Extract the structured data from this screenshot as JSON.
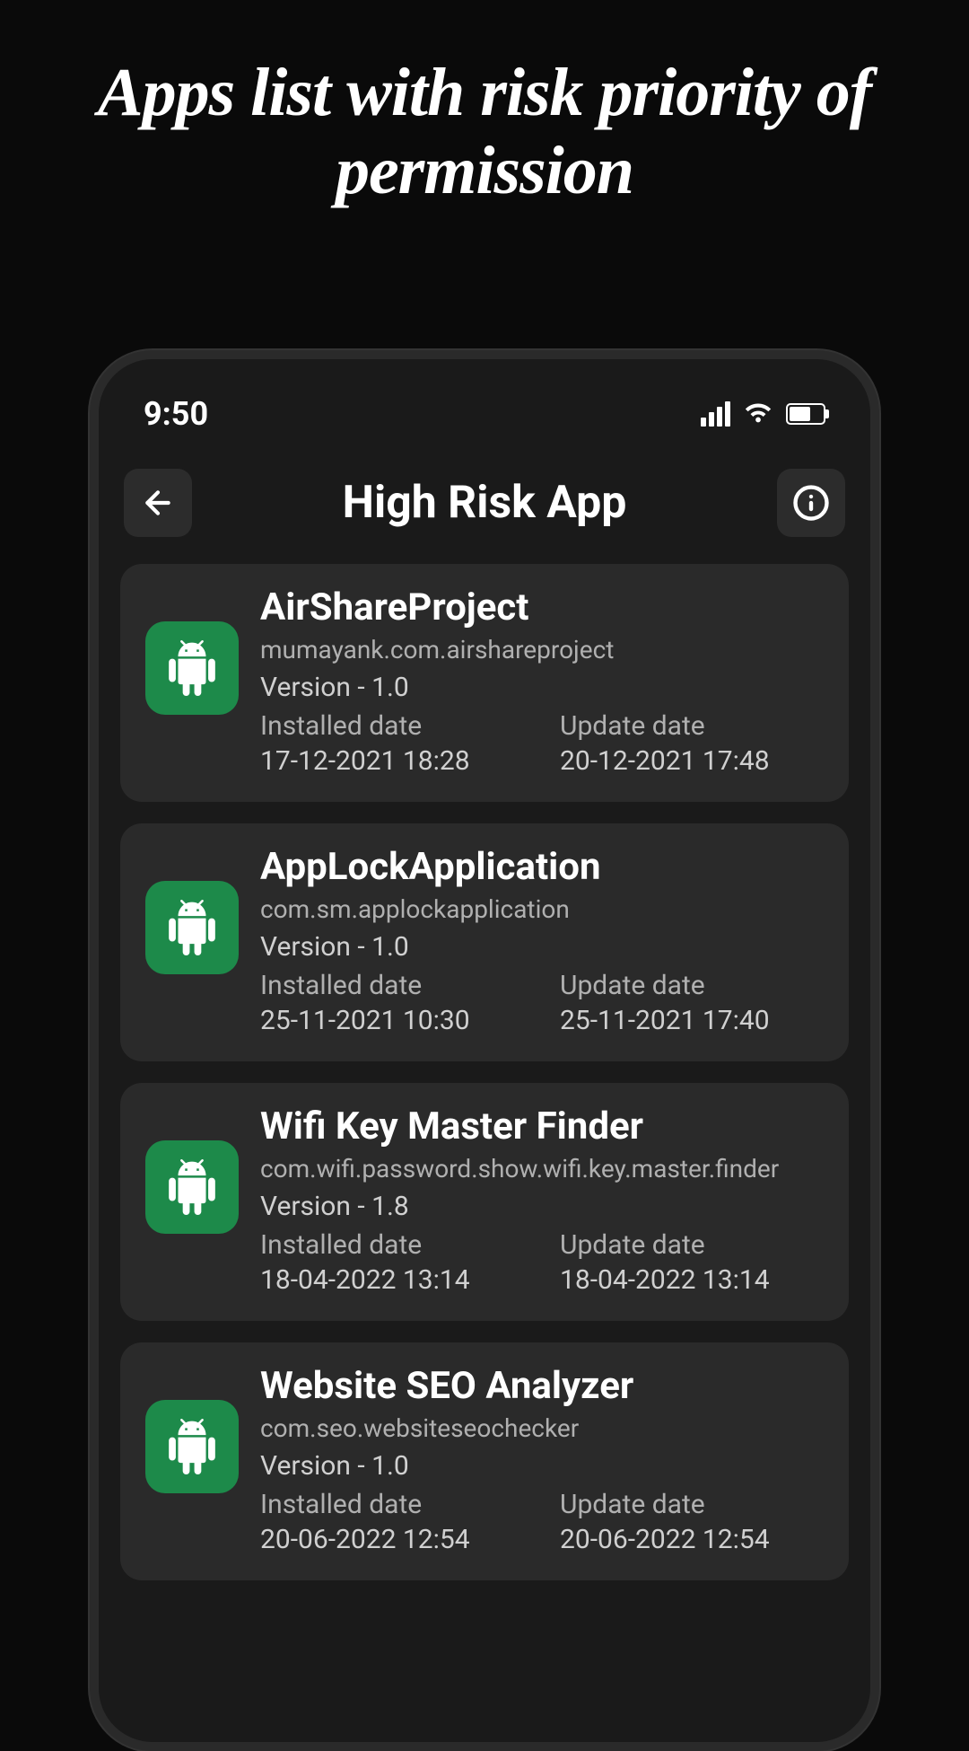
{
  "promo": {
    "title": "Apps list with risk priority of permission"
  },
  "status_bar": {
    "time": "9:50"
  },
  "header": {
    "title": "High Risk App"
  },
  "apps": [
    {
      "name": "AirShareProject",
      "package": "mumayank.com.airshareproject",
      "version": "Version - 1.0",
      "installed_label": "Installed date",
      "installed_date": "17-12-2021 18:28",
      "update_label": "Update date",
      "update_date": "20-12-2021 17:48"
    },
    {
      "name": "AppLockApplication",
      "package": "com.sm.applockapplication",
      "version": "Version - 1.0",
      "installed_label": "Installed date",
      "installed_date": "25-11-2021 10:30",
      "update_label": "Update date",
      "update_date": "25-11-2021 17:40"
    },
    {
      "name": "Wifi Key Master Finder",
      "package": "com.wifi.password.show.wifi.key.master.finder",
      "version": "Version - 1.8",
      "installed_label": "Installed date",
      "installed_date": "18-04-2022 13:14",
      "update_label": "Update date",
      "update_date": "18-04-2022 13:14"
    },
    {
      "name": "Website SEO Analyzer",
      "package": "com.seo.websiteseochecker",
      "version": "Version - 1.0",
      "installed_label": "Installed date",
      "installed_date": "20-06-2022 12:54",
      "update_label": "Update date",
      "update_date": "20-06-2022 12:54"
    }
  ]
}
